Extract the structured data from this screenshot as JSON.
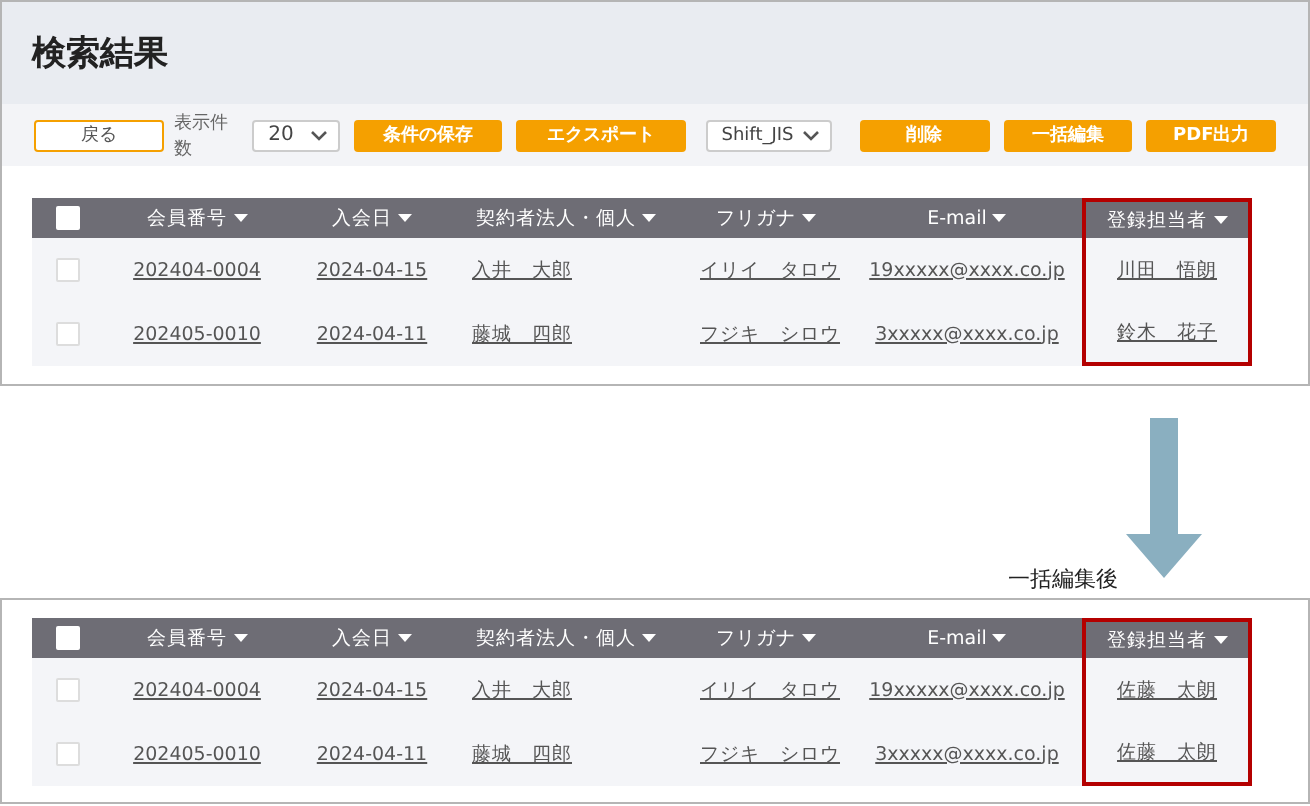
{
  "page_title": "検索結果",
  "toolbar": {
    "back_button": "戻る",
    "count_label": "表示件数",
    "count_select": "20",
    "buttons_left": [
      "条件の保存",
      "エクスポート"
    ],
    "encoding_select": "Shift_JIS",
    "buttons_right": [
      "削除",
      "一括編集",
      "PDF出力"
    ]
  },
  "tables": [
    {
      "header_checked": false,
      "columns": [
        {
          "label": "会員番号",
          "highlighted": false
        },
        {
          "label": "入会日",
          "highlighted": false
        },
        {
          "label": "契約者法人・個人",
          "highlighted": false
        },
        {
          "label": "フリガナ",
          "highlighted": false
        },
        {
          "label": "E-mail",
          "highlighted": false
        },
        {
          "label": "登録担当者",
          "highlighted": true
        }
      ],
      "rows": [
        {
          "checked": false,
          "cells": [
            "202404-0004",
            "2024-04-15",
            "入井　大郎",
            "イリイ　タロウ",
            "19xxxxx@xxxx.co.jp",
            "川田　悟朗"
          ]
        },
        {
          "checked": false,
          "cells": [
            "202405-0010",
            "2024-04-11",
            "藤城　四郎",
            "フジキ　シロウ",
            "3xxxxx@xxxx.co.jp",
            "鈴木　花子"
          ]
        }
      ]
    },
    {
      "header_checked": false,
      "columns": [
        {
          "label": "会員番号",
          "highlighted": false
        },
        {
          "label": "入会日",
          "highlighted": false
        },
        {
          "label": "契約者法人・個人",
          "highlighted": false
        },
        {
          "label": "フリガナ",
          "highlighted": false
        },
        {
          "label": "E-mail",
          "highlighted": false
        },
        {
          "label": "登録担当者",
          "highlighted": true
        }
      ],
      "rows": [
        {
          "checked": false,
          "cells": [
            "202404-0004",
            "2024-04-15",
            "入井　大郎",
            "イリイ　タロウ",
            "19xxxxx@xxxx.co.jp",
            "佐藤　太朗"
          ]
        },
        {
          "checked": false,
          "cells": [
            "202405-0010",
            "2024-04-11",
            "藤城　四郎",
            "フジキ　シロウ",
            "3xxxxx@xxxx.co.jp",
            "佐藤　太朗"
          ]
        }
      ]
    }
  ],
  "arrow_label": "一括編集後"
}
